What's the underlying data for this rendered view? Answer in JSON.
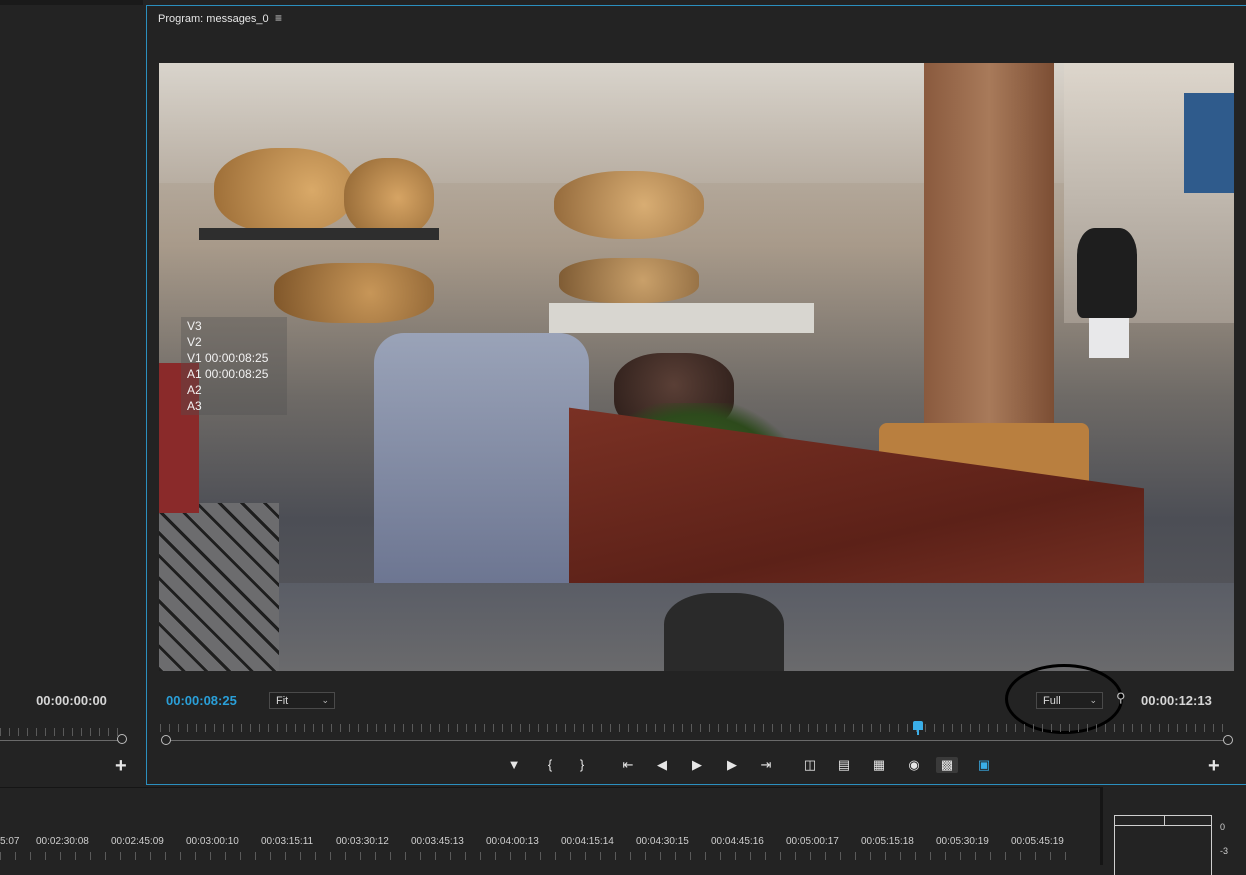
{
  "source_monitor": {
    "timecode": "00:00:00:00",
    "add_button": "+"
  },
  "program_monitor": {
    "title": "Program: messages_0",
    "menu_icon": "≡",
    "track_overlay": [
      "V3",
      "V2",
      "V1 00:00:08:25",
      "A1 00:00:08:25",
      "A2",
      "A3"
    ],
    "current_timecode": "00:00:08:25",
    "zoom_dropdown": "Fit",
    "resolution_dropdown": "Full",
    "duration_timecode": "00:00:12:13",
    "playhead_fraction": 0.71,
    "add_button": "+",
    "transport_icons": [
      "marker-icon",
      "mark-in-icon",
      "mark-out-icon",
      "go-to-in-icon",
      "step-back-icon",
      "play-icon",
      "step-forward-icon",
      "go-to-out-icon",
      "insert-icon",
      "overwrite-icon",
      "export-frame-icon",
      "camera-icon",
      "compare-view-icon",
      "vr-video-icon"
    ]
  },
  "timeline": {
    "ruler_labels": [
      "5:07",
      "00:02:30:08",
      "00:02:45:09",
      "00:03:00:10",
      "00:03:15:11",
      "00:03:30:12",
      "00:03:45:13",
      "00:04:00:13",
      "00:04:15:14",
      "00:04:30:15",
      "00:04:45:16",
      "00:05:00:17",
      "00:05:15:18",
      "00:05:30:19",
      "00:05:45:19"
    ]
  },
  "audio_meter": {
    "labels": [
      "0",
      "-3"
    ]
  },
  "colors": {
    "accent_blue": "#2a9fd8",
    "panel_border": "#2b8fbf",
    "background": "#232323"
  }
}
